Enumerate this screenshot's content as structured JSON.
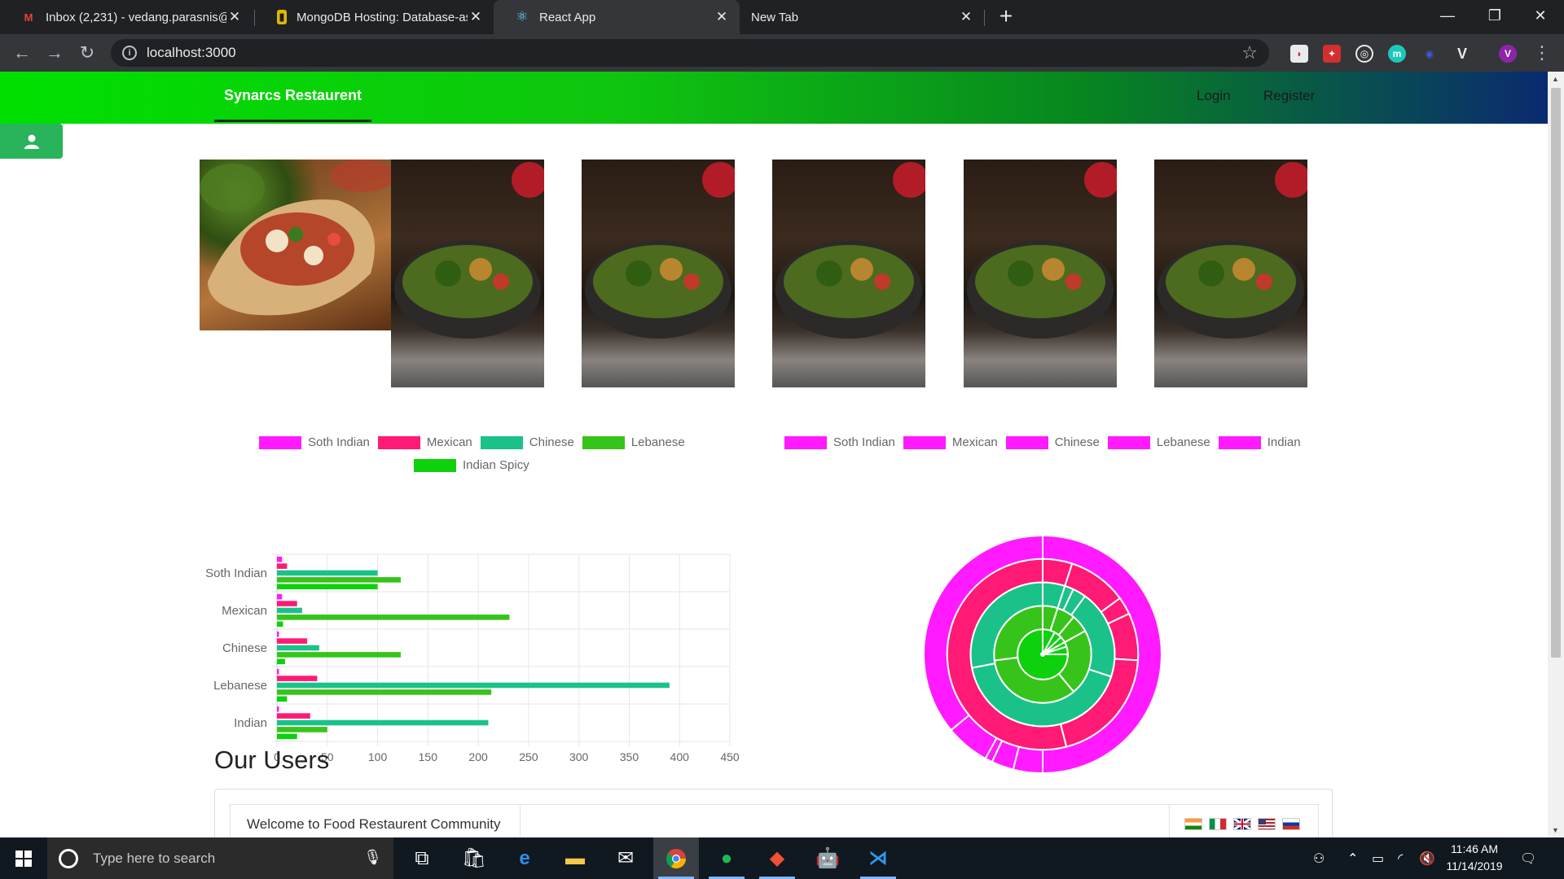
{
  "browser": {
    "tabs": [
      {
        "title": "Inbox (2,231) - vedang.parasnis@",
        "icon": "gmail-icon"
      },
      {
        "title": "MongoDB Hosting: Database-as-",
        "icon": "mongodb-icon"
      },
      {
        "title": "React App",
        "icon": "react-icon",
        "active": true
      },
      {
        "title": "New Tab",
        "icon": ""
      }
    ],
    "url": "localhost:3000",
    "profile_initial": "V"
  },
  "page": {
    "brand": "Synarcs Restaurent",
    "nav_links": [
      "Login",
      "Register"
    ],
    "section_title": "Our Users",
    "welcome_text": "Welcome to Food Restaurent Community"
  },
  "colors": {
    "pink": "#ff1aff",
    "crimson": "#ff1a75",
    "teal": "#1ac28a",
    "green": "#36c41a",
    "brightgreen": "#0dd10d"
  },
  "chart_data": [
    {
      "type": "bar",
      "orientation": "horizontal",
      "categories": [
        "Soth Indian",
        "Mexican",
        "Chinese",
        "Lebanese",
        "Indian"
      ],
      "series": [
        {
          "name": "Soth Indian",
          "color": "#ff1aff",
          "values": [
            5,
            5,
            2,
            2,
            2
          ]
        },
        {
          "name": "Mexican",
          "color": "#ff1a75",
          "values": [
            10,
            20,
            30,
            40,
            33
          ]
        },
        {
          "name": "Chinese",
          "color": "#1ac28a",
          "values": [
            100,
            25,
            42,
            390,
            210
          ]
        },
        {
          "name": "Lebanese",
          "color": "#36c41a",
          "values": [
            123,
            231,
            123,
            213,
            50
          ]
        },
        {
          "name": "Indian Spicy",
          "color": "#0dd10d",
          "values": [
            100,
            6,
            8,
            10,
            20
          ]
        }
      ],
      "xlim": [
        0,
        450
      ],
      "xticks": [
        0,
        50,
        100,
        150,
        200,
        250,
        300,
        350,
        400,
        450
      ],
      "grid": true,
      "legend": "top"
    },
    {
      "type": "pie",
      "variant": "multi-ring doughnut",
      "legend_labels": [
        "Soth Indian",
        "Mexican",
        "Chinese",
        "Lebanese",
        "Indian"
      ],
      "legend_color": "#ff1aff",
      "rings": [
        {
          "color": "#ff1aff",
          "values": [
            50,
            4,
            3,
            1,
            6,
            36
          ]
        },
        {
          "color": "#ff1a75",
          "values": [
            5,
            10,
            3,
            8,
            20,
            54
          ]
        },
        {
          "color": "#1ac28a",
          "values": [
            5,
            2,
            3,
            20,
            42,
            28
          ]
        },
        {
          "color": "#36c41a",
          "values": [
            5,
            6,
            6,
            22,
            34,
            27
          ]
        },
        {
          "color": "#0dd10d",
          "values": [
            8,
            5,
            4,
            3,
            5,
            75
          ]
        }
      ],
      "legend": "top"
    }
  ],
  "taskbar": {
    "search_placeholder": "Type here to search",
    "time": "11:46 AM",
    "date": "11/14/2019"
  }
}
